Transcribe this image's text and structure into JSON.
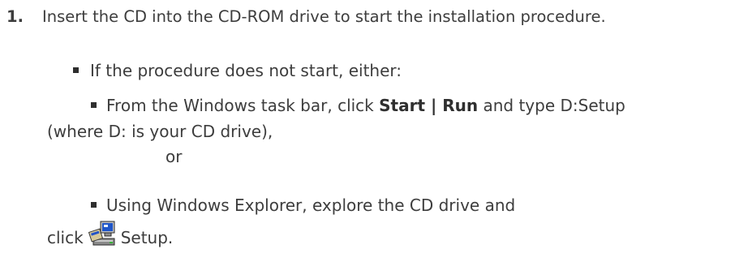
{
  "step": {
    "number": "1.",
    "text": "Insert the CD into the CD-ROM drive to start the installation procedure."
  },
  "sub": {
    "intro": "If the procedure does not start, either:",
    "option1": {
      "prefix": "From the Windows task bar, click ",
      "bold": "Start | Run",
      "suffix": " and type D:Setup",
      "wrap": "(where D: is your CD drive),"
    },
    "or": "or",
    "option2": {
      "line1": "Using Windows Explorer, explore the CD drive and",
      "click": "click",
      "icon": "setup-computer-icon",
      "setup": "Setup."
    }
  }
}
